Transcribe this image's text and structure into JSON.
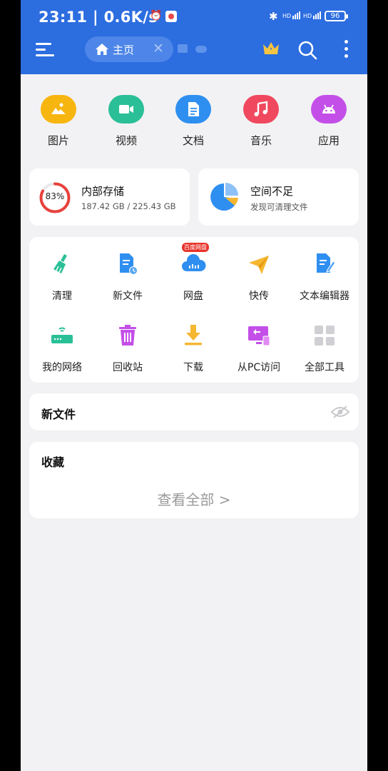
{
  "status": {
    "time": "23:11",
    "speed": "0.6K/s",
    "battery": "96",
    "sim1_label": "HD",
    "sim2_label": "HD"
  },
  "nav": {
    "tab_label": "主页"
  },
  "categories": [
    {
      "label": "图片",
      "color": "#f7b50f",
      "icon": "image-icon"
    },
    {
      "label": "视频",
      "color": "#2bbf97",
      "icon": "video-icon"
    },
    {
      "label": "文档",
      "color": "#2f8ff0",
      "icon": "document-icon"
    },
    {
      "label": "音乐",
      "color": "#f0485e",
      "icon": "music-icon"
    },
    {
      "label": "应用",
      "color": "#c34fe8",
      "icon": "android-icon"
    }
  ],
  "storage": {
    "title": "内部存储",
    "percent": 83,
    "percent_label": "83%",
    "usage": "187.42 GB / 225.43 GB"
  },
  "space": {
    "title": "空间不足",
    "subtitle": "发现可清理文件"
  },
  "tools": [
    {
      "label": "清理",
      "icon": "broom-icon"
    },
    {
      "label": "新文件",
      "icon": "new-file-icon"
    },
    {
      "label": "网盘",
      "icon": "cloud-drive-icon",
      "badge": "百度网盘"
    },
    {
      "label": "快传",
      "icon": "paper-plane-icon"
    },
    {
      "label": "文本编辑器",
      "icon": "text-editor-icon"
    },
    {
      "label": "我的网络",
      "icon": "router-icon"
    },
    {
      "label": "回收站",
      "icon": "trash-icon"
    },
    {
      "label": "下载",
      "icon": "download-icon"
    },
    {
      "label": "从PC访问",
      "icon": "pc-access-icon"
    },
    {
      "label": "全部工具",
      "icon": "grid-icon"
    }
  ],
  "new_files": {
    "title": "新文件"
  },
  "favorites": {
    "title": "收藏",
    "view_all": "查看全部 >"
  },
  "colors": {
    "accent": "#2c6de0",
    "storage_ring": "#e8423c",
    "background": "#f2f2f4"
  }
}
